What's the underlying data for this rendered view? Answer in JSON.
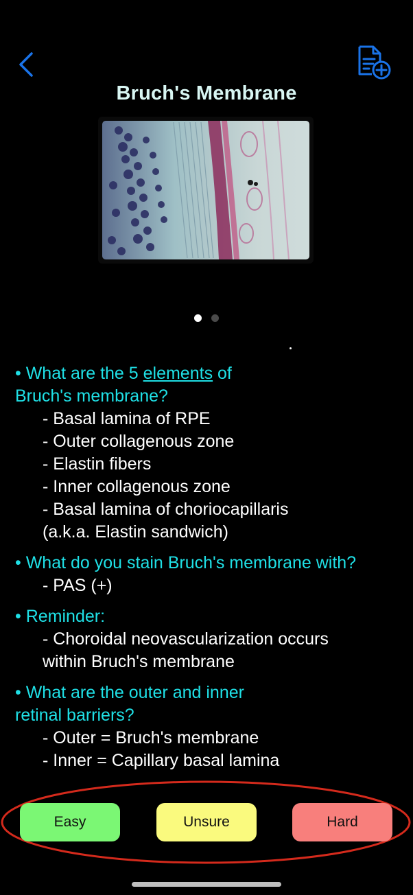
{
  "header": {
    "back_icon": "chevron-left-icon",
    "add_note_icon": "document-plus-icon",
    "accent_color": "#1a73e8",
    "title": "Bruch's Membrane"
  },
  "carousel": {
    "image_icon": "histology-slide-image",
    "page_count": 2,
    "current_page": 1
  },
  "content": {
    "question_color": "#1fe0e6",
    "q1_prefix": "• What are the 5 ",
    "q1_link": "elements",
    "q1_suffix": " of",
    "q1_line2": "Bruch's membrane?",
    "q1_answers": [
      "- Basal lamina of RPE",
      "- Outer collagenous zone",
      "- Elastin fibers",
      "- Inner collagenous zone",
      "- Basal lamina of choriocapillaris",
      "(a.k.a. Elastin sandwich)"
    ],
    "q2": "• What do you stain Bruch's membrane with?",
    "q2_answers": [
      "- PAS (+)"
    ],
    "q3": "• Reminder:",
    "q3_answers": [
      "- Choroidal neovascularization occurs",
      "within Bruch's membrane"
    ],
    "q4_line1": "• What are the outer and inner",
    "q4_line2": "retinal barriers?",
    "q4_answers": [
      "- Outer = Bruch's membrane",
      "- Inner = Capillary basal lamina"
    ]
  },
  "rating": {
    "easy_label": "Easy",
    "unsure_label": "Unsure",
    "hard_label": "Hard",
    "easy_color": "#7bf774",
    "unsure_color": "#fafa7e",
    "hard_color": "#f87f7c",
    "highlight_color": "#d42a1c"
  }
}
